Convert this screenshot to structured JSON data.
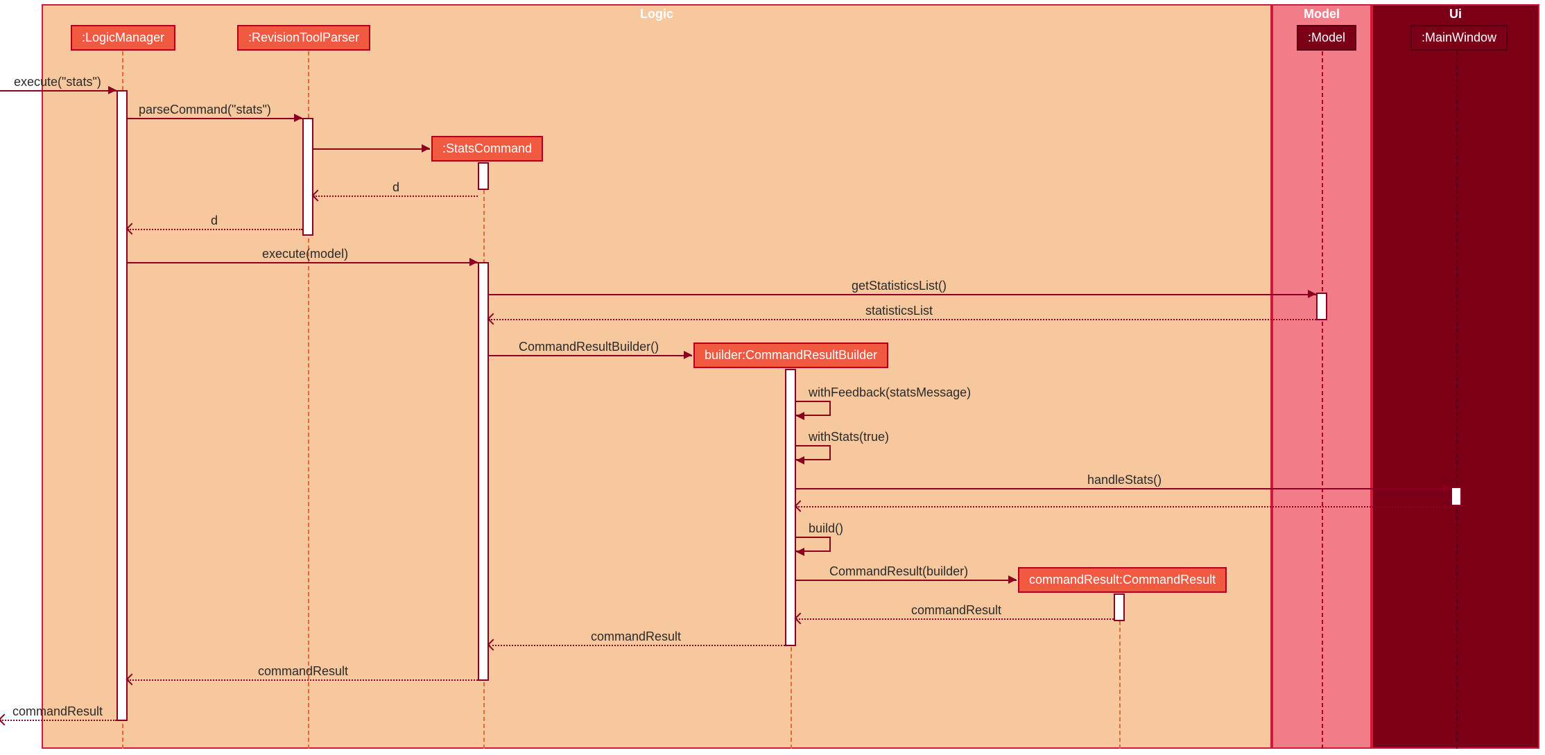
{
  "frames": {
    "logic": {
      "title": "Logic",
      "bg": "#F7C79E",
      "border": "#D5173B",
      "title_color": "#fff"
    },
    "model": {
      "title": "Model",
      "bg": "#F27C87",
      "border": "#D5173B",
      "title_color": "#fff"
    },
    "ui": {
      "title": "Ui",
      "bg": "#7B0017",
      "border": "#D5173B",
      "title_color": "#fff"
    }
  },
  "participants": {
    "logicManager": {
      "label": ":LogicManager",
      "bg": "#F15A40",
      "border": "#AE0022",
      "color": "#fff"
    },
    "revisionToolParser": {
      "label": ":RevisionToolParser",
      "bg": "#F15A40",
      "border": "#AE0022",
      "color": "#fff"
    },
    "statsCommand": {
      "label": ":StatsCommand",
      "bg": "#F15A40",
      "border": "#AE0022",
      "color": "#fff"
    },
    "commandResultBuilder": {
      "label": "builder:CommandResultBuilder",
      "bg": "#F15A40",
      "border": "#AE0022",
      "color": "#fff"
    },
    "commandResult": {
      "label": "commandResult:CommandResult",
      "bg": "#F15A40",
      "border": "#AE0022",
      "color": "#fff"
    },
    "model": {
      "label": ":Model",
      "bg": "#7B0017",
      "border": "#560013",
      "color": "#fff"
    },
    "mainWindow": {
      "label": ":MainWindow",
      "bg": "#7B0017",
      "border": "#560013",
      "color": "#fff"
    }
  },
  "messages": {
    "executeStats": "execute(\"stats\")",
    "parseCommand": "parseCommand(\"stats\")",
    "d1": "d",
    "d2": "d",
    "executeModel": "execute(model)",
    "getStatisticsList": "getStatisticsList()",
    "statisticsList": "statisticsList",
    "commandResultBuilder": "CommandResultBuilder()",
    "withFeedback": "withFeedback(statsMessage)",
    "withStats": "withStats(true)",
    "handleStats": "handleStats()",
    "build": "build()",
    "commandResultCall": "CommandResult(builder)",
    "commandResultReturn": "commandResult",
    "commandResultReturn2": "commandResult",
    "commandResultReturn3": "commandResult",
    "commandResultReturn4": "commandResult"
  }
}
